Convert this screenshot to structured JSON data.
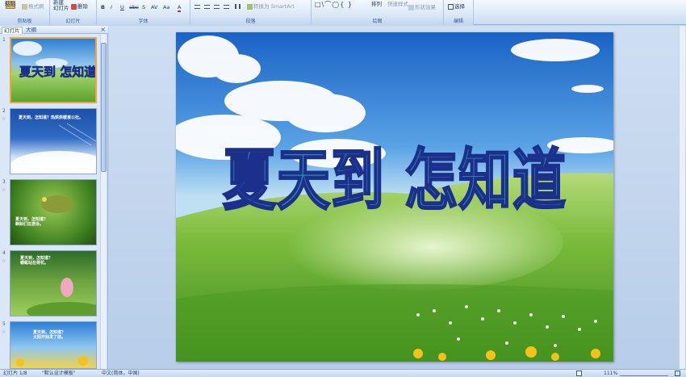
{
  "ribbon": {
    "clipboard": {
      "paste": "粘贴",
      "format_painter": "格式刷",
      "group_label": "剪贴板"
    },
    "slides": {
      "new_slide": "新建\n幻灯片",
      "delete": "删除",
      "group_label": "幻灯片"
    },
    "font": {
      "group_label": "字体",
      "buttons": [
        "B",
        "I",
        "U",
        "abc",
        "S",
        "AV",
        "Aa",
        "A"
      ]
    },
    "paragraph": {
      "convert_smartart": "转换为 SmartArt",
      "group_label": "段落"
    },
    "drawing": {
      "arrange": "排列",
      "quick_styles": "快速样式",
      "shape_effects": "形状效果",
      "group_label": "绘图"
    },
    "editing": {
      "select": "选择",
      "group_label": "编辑"
    }
  },
  "panel": {
    "tabs": [
      "幻灯片",
      "大纲"
    ],
    "close": "×",
    "thumbnails": [
      {
        "number": "1",
        "title": "夏天到 怎知道",
        "selected": true
      },
      {
        "number": "2",
        "text": "夏天到，怎知道？热烘烘暖意公社。"
      },
      {
        "number": "3",
        "text": "夏天到，怎知道？\n蝌蚪们在游泳。"
      },
      {
        "number": "4",
        "text": "夏天到，怎知道？\n蜻蜓站在荷花。"
      },
      {
        "number": "5",
        "text": "夏天到，怎知道？\n太阳开始发了烧。"
      }
    ]
  },
  "slide": {
    "title": "夏天到 怎知道"
  },
  "status": {
    "slide_counter": "幻灯片 1/8",
    "theme": "\"默认设计模板\"",
    "language": "中文(简体，中国)",
    "zoom": "111%"
  },
  "colors": {
    "title_fill": "#2a8fa8",
    "title_stroke": "#1c2f8a",
    "selection": "#f2a436"
  }
}
